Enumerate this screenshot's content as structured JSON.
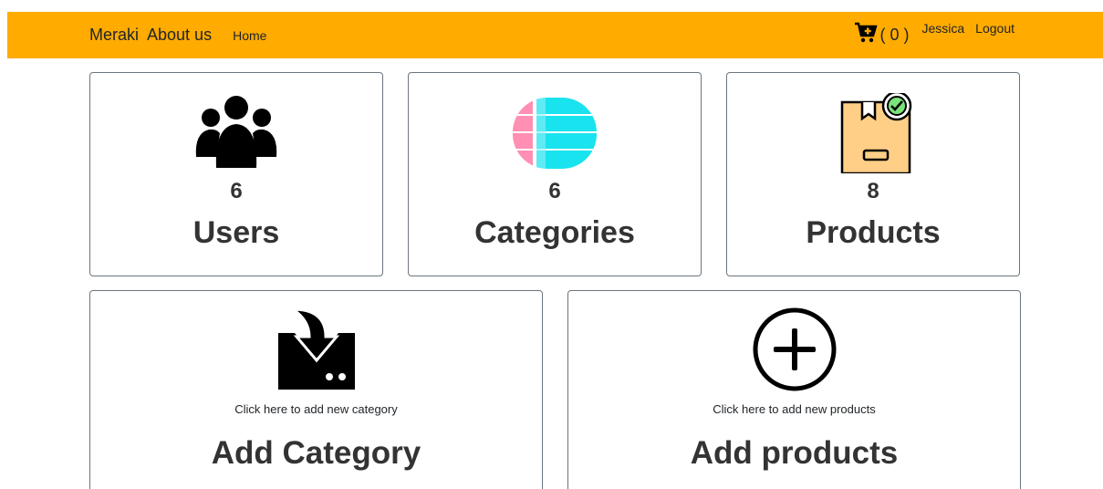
{
  "navbar": {
    "brand": "Meraki",
    "about": "About us",
    "home": "Home",
    "cart_count": "( 0 )",
    "user": "Jessica",
    "logout": "Logout",
    "bg_color": "#ffab00"
  },
  "stats": [
    {
      "icon": "users-icon",
      "value": "6",
      "label": "Users"
    },
    {
      "icon": "categories-icon",
      "value": "6",
      "label": "Categories"
    },
    {
      "icon": "products-box-icon",
      "value": "8",
      "label": "Products"
    }
  ],
  "actions": [
    {
      "icon": "add-category-download-icon",
      "hint": "Click here to add new category",
      "label": "Add Category"
    },
    {
      "icon": "plus-circle-icon",
      "hint": "Click here to add new products",
      "label": "Add products"
    }
  ]
}
